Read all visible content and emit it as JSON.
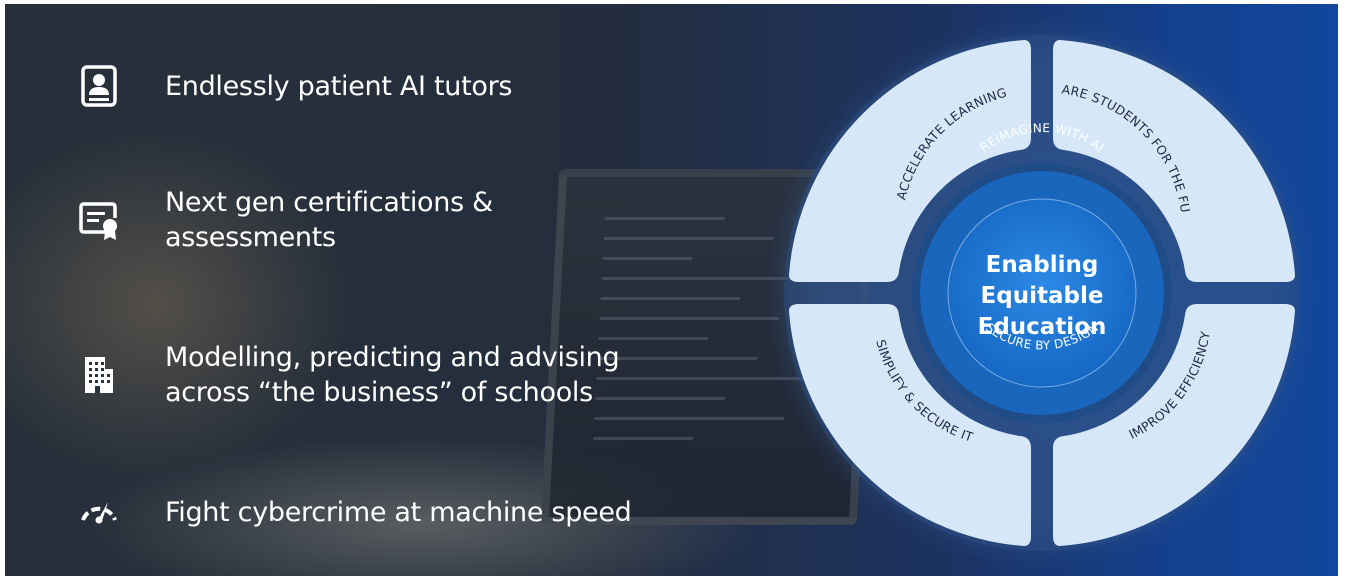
{
  "features": [
    {
      "icon": "tutor-profile-icon",
      "lines": [
        "Endlessly patient AI tutors"
      ]
    },
    {
      "icon": "certificate-icon",
      "lines": [
        "Next gen certifications &",
        "assessments"
      ]
    },
    {
      "icon": "building-icon",
      "lines": [
        "Modelling, predicting and advising",
        "across “the business” of schools"
      ]
    },
    {
      "icon": "speedometer-icon",
      "lines": [
        "Fight cybercrime at machine speed"
      ]
    }
  ],
  "wheel": {
    "segments": [
      "ACCELERATE LEARNING",
      "PREPARE STUDENTS FOR THE FUTURE",
      "IMPROVE EFFICIENCY",
      "SIMPLIFY & SECURE IT"
    ],
    "ring_top": "REIMAGINE WITH AI",
    "ring_bottom": "SECURE BY DESIGN",
    "center": [
      "Enabling",
      "Equitable",
      "Education"
    ]
  },
  "colors": {
    "segment_fill": "#d6e8f8",
    "ring_fill": "#1f4b86",
    "center_fill": "#1878d6",
    "outer_halo": "#3a5f95"
  }
}
